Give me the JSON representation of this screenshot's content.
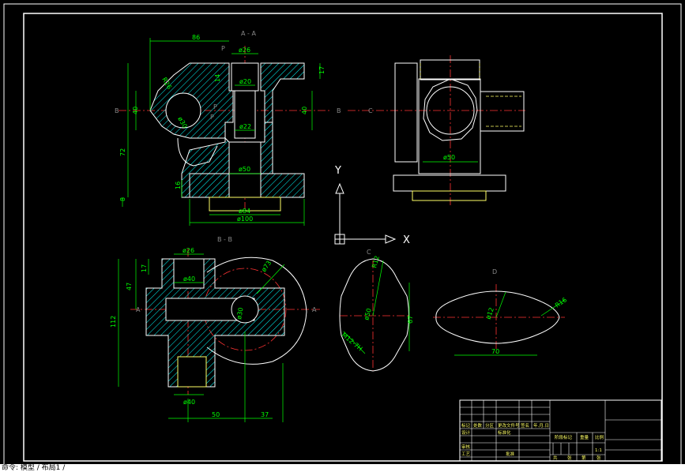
{
  "colors": {
    "background": "#000000",
    "outline": "#ffffff",
    "hidden": "#ffff66",
    "dimension": "#00ff00",
    "centerline": "#ff3333",
    "hatch": "#00ffff",
    "axis": "#ffffff"
  },
  "views": {
    "section_aa": "A - A",
    "section_bb": "B - B",
    "view_c": "C",
    "view_d": "D",
    "cut_a_left": "A",
    "cut_a_right": "A",
    "cut_b_left": "B",
    "cut_b_right": "B",
    "cut_b_right2": "B",
    "cut_c": "C",
    "cut_p1": "P",
    "cut_p2": "P",
    "cut_p3": "P"
  },
  "dims_aa": {
    "d_top": "86",
    "d_26": "ø26",
    "d_20": "ø20",
    "d_22": "ø22",
    "d_50": "ø50",
    "d_84": "ø84",
    "d_100": "ø100",
    "d_17": "17",
    "d_40r": "40",
    "d_40l": "40",
    "d_72": "72",
    "d_8": "8",
    "d_16": "16",
    "d_r26": "R26",
    "d_r30": "ø30",
    "d_14": "14"
  },
  "dims_top": {
    "d_50": "ø50"
  },
  "dims_bb": {
    "d_26": "ø26",
    "d_40a": "ø40",
    "d_40b": "ø40",
    "d_17": "17",
    "d_47": "47",
    "d_112": "112",
    "d_50": "50",
    "d_37": "37",
    "d_r73": "ø73",
    "d_r30": "ø30"
  },
  "dims_c": {
    "d_r12": "R12",
    "d_50": "ø50",
    "d_67": "67",
    "d_m": "M12-7H"
  },
  "dims_d": {
    "d_r16": "R16",
    "d_r12": "ø12",
    "d_70": "70"
  },
  "axis": {
    "x_label": "X",
    "y_label": "Y"
  },
  "title_block": {
    "r1c1": "标记",
    "r1c2": "处数",
    "r1c3": "分区",
    "r1c4": "更改文件号",
    "r1c5": "签名",
    "r1c6": "年.月.日",
    "r2c1": "设计",
    "r2c3": "标准化",
    "stage": "阶段标记",
    "weight": "重量",
    "scale_lbl": "比例",
    "scale": "1:1",
    "r4c1": "审核",
    "r5c1": "工艺",
    "approve": "批准",
    "sheets": "共",
    "sheet_of": "张",
    "sheet_no": "第",
    "sheet_end": "张"
  },
  "command_line": "命令: 模型 / 布局1 /"
}
